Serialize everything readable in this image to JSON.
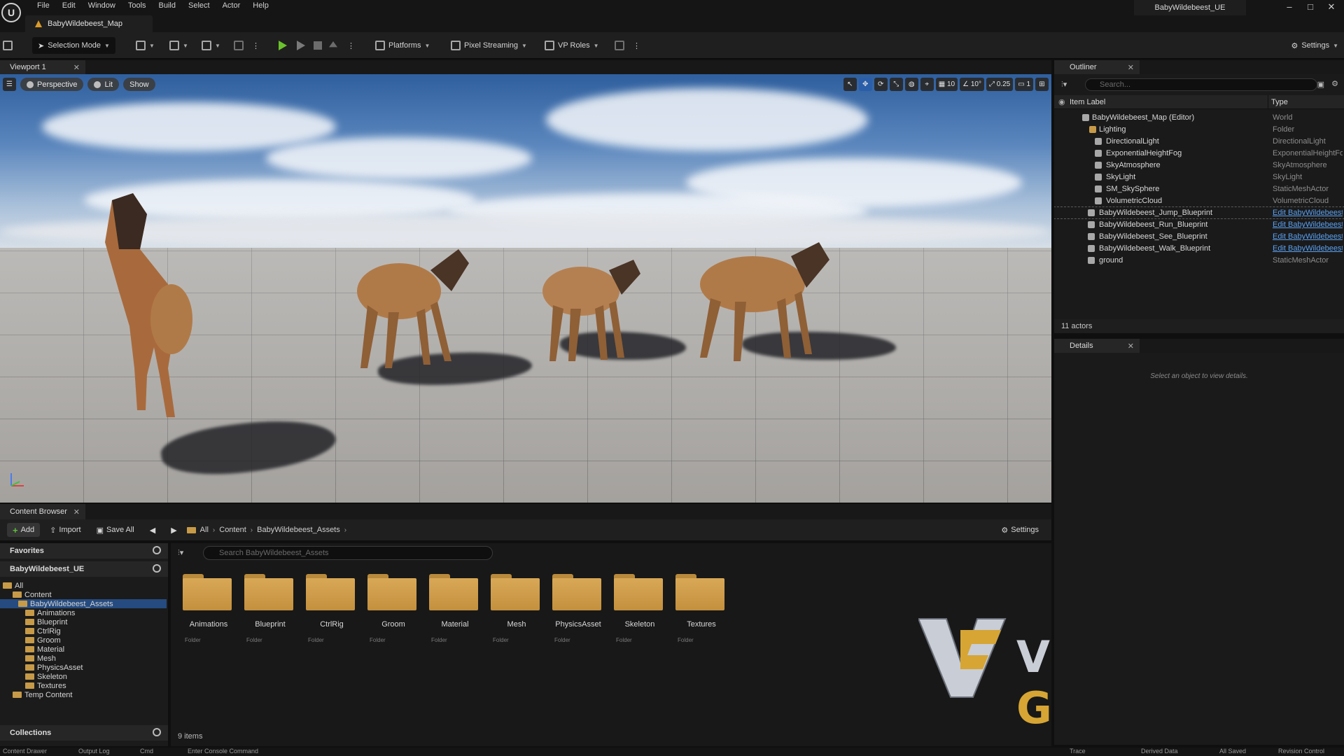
{
  "titlebar": {
    "menu": [
      "File",
      "Edit",
      "Window",
      "Tools",
      "Build",
      "Select",
      "Actor",
      "Help"
    ],
    "doc_tab": "BabyWildebeest_Map",
    "project_name": "BabyWildebeest_UE"
  },
  "toolbar": {
    "selection_mode": "Selection Mode",
    "platforms": "Platforms",
    "pixel_streaming": "Pixel Streaming",
    "vp_roles": "VP Roles",
    "settings": "Settings"
  },
  "viewport": {
    "tab": "Viewport 1",
    "perspective": "Perspective",
    "lit": "Lit",
    "show": "Show",
    "grid_snap": "10",
    "rot_snap": "10°",
    "scale_snap": "0.25",
    "camera_speed": "1"
  },
  "content_browser": {
    "tab": "Content Browser",
    "add": "Add",
    "import": "Import",
    "save_all": "Save All",
    "breadcrumbs": [
      "All",
      "Content",
      "BabyWildebeest_Assets"
    ],
    "settings": "Settings",
    "favorites": "Favorites",
    "project": "BabyWildebeest_UE",
    "collections": "Collections",
    "search_placeholder": "Search BabyWildebeest_Assets",
    "tree": [
      "All",
      "Content",
      "BabyWildebeest_Assets",
      "Animations",
      "Blueprint",
      "CtrlRig",
      "Groom",
      "Material",
      "Mesh",
      "PhysicsAsset",
      "Skeleton",
      "Textures",
      "Temp Content"
    ],
    "folders": [
      {
        "name": "Animations",
        "kind": "Folder"
      },
      {
        "name": "Blueprint",
        "kind": "Folder"
      },
      {
        "name": "CtrlRig",
        "kind": "Folder"
      },
      {
        "name": "Groom",
        "kind": "Folder"
      },
      {
        "name": "Material",
        "kind": "Folder"
      },
      {
        "name": "Mesh",
        "kind": "Folder"
      },
      {
        "name": "PhysicsAsset",
        "kind": "Folder"
      },
      {
        "name": "Skeleton",
        "kind": "Folder"
      },
      {
        "name": "Textures",
        "kind": "Folder"
      }
    ],
    "count": "9 items"
  },
  "outliner": {
    "tab": "Outliner",
    "search_placeholder": "Search...",
    "col_label": "Item Label",
    "col_type": "Type",
    "rows": [
      {
        "label": "BabyWildebeest_Map (Editor)",
        "type": "World",
        "link": false
      },
      {
        "label": "Lighting",
        "type": "Folder",
        "link": false
      },
      {
        "label": "DirectionalLight",
        "type": "DirectionalLight",
        "link": false
      },
      {
        "label": "ExponentialHeightFog",
        "type": "ExponentialHeightFog",
        "link": false
      },
      {
        "label": "SkyAtmosphere",
        "type": "SkyAtmosphere",
        "link": false
      },
      {
        "label": "SkyLight",
        "type": "SkyLight",
        "link": false
      },
      {
        "label": "SM_SkySphere",
        "type": "StaticMeshActor",
        "link": false
      },
      {
        "label": "VolumetricCloud",
        "type": "VolumetricCloud",
        "link": false
      },
      {
        "label": "BabyWildebeest_Jump_Blueprint",
        "type": "Edit BabyWildebeest_",
        "link": true
      },
      {
        "label": "BabyWildebeest_Run_Blueprint",
        "type": "Edit BabyWildebeest_",
        "link": true
      },
      {
        "label": "BabyWildebeest_See_Blueprint",
        "type": "Edit BabyWildebeest_",
        "link": true
      },
      {
        "label": "BabyWildebeest_Walk_Blueprint",
        "type": "Edit BabyWildebeest_",
        "link": true
      },
      {
        "label": "ground",
        "type": "StaticMeshActor",
        "link": false
      }
    ],
    "footer": "11 actors"
  },
  "details": {
    "tab": "Details",
    "empty": "Select an object to view details."
  },
  "watermark": {
    "part1": "VFX ",
    "part2": "GRACE"
  },
  "statusbar": {
    "content_drawer": "Content Drawer",
    "output_log": "Output Log",
    "cmd": "Cmd",
    "console_placeholder": "Enter Console Command",
    "trace": "Trace",
    "derived_data": "Derived Data",
    "all_saved": "All Saved",
    "revision_control": "Revision Control"
  },
  "colors": {
    "accent": "#254b80",
    "play": "#6ac12c",
    "folder": "#d9a856",
    "link": "#5aa0f0"
  }
}
